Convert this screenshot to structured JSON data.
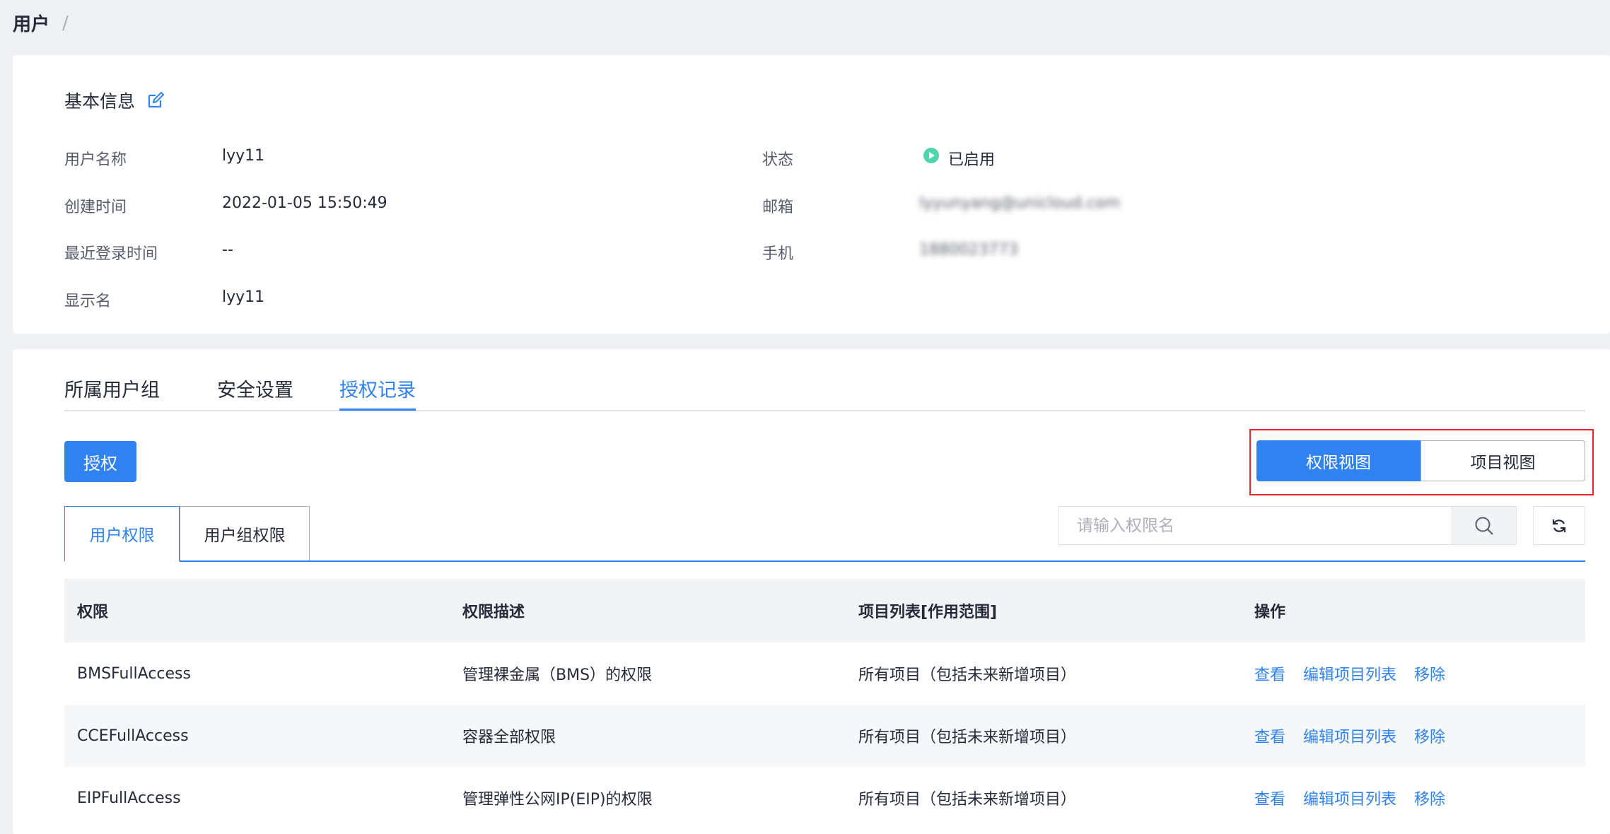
{
  "breadcrumb": {
    "current": "用户",
    "separator": "/"
  },
  "basic_info": {
    "title": "基本信息",
    "fields": {
      "username_label": "用户名称",
      "username_value": "lyy11",
      "created_label": "创建时间",
      "created_value": "2022-01-05 15:50:49",
      "last_login_label": "最近登录时间",
      "last_login_value": "--",
      "display_name_label": "显示名",
      "display_name_value": "lyy11",
      "status_label": "状态",
      "status_value": "已启用",
      "email_label": "邮箱",
      "email_value": "lyyunyang@unicloud.com",
      "phone_label": "手机",
      "phone_value": "1880023773"
    }
  },
  "tabs": [
    "所属用户组",
    "安全设置",
    "授权记录"
  ],
  "active_tab": "授权记录",
  "toolbar": {
    "grant_label": "授权"
  },
  "view_toggle": {
    "permission_view": "权限视图",
    "project_view": "项目视图",
    "selected": "权限视图"
  },
  "subtabs": {
    "user_permission": "用户权限",
    "group_permission": "用户组权限"
  },
  "search": {
    "placeholder": "请输入权限名"
  },
  "table": {
    "headers": [
      "权限",
      "权限描述",
      "项目列表[作用范围]",
      "操作"
    ],
    "rows": [
      {
        "name": "BMSFullAccess",
        "desc": "管理裸金属（BMS）的权限",
        "scope": "所有项目（包括未来新增项目）"
      },
      {
        "name": "CCEFullAccess",
        "desc": "容器全部权限",
        "scope": "所有项目（包括未来新增项目）"
      },
      {
        "name": "EIPFullAccess",
        "desc": "管理弹性公网IP(EIP)的权限",
        "scope": "所有项目（包括未来新增项目）"
      }
    ],
    "actions": {
      "view": "查看",
      "edit": "编辑项目列表",
      "remove": "移除"
    }
  },
  "colors": {
    "accent": "#2f82f0",
    "status_green": "#50d4ab",
    "highlight_red": "#e8242d"
  }
}
